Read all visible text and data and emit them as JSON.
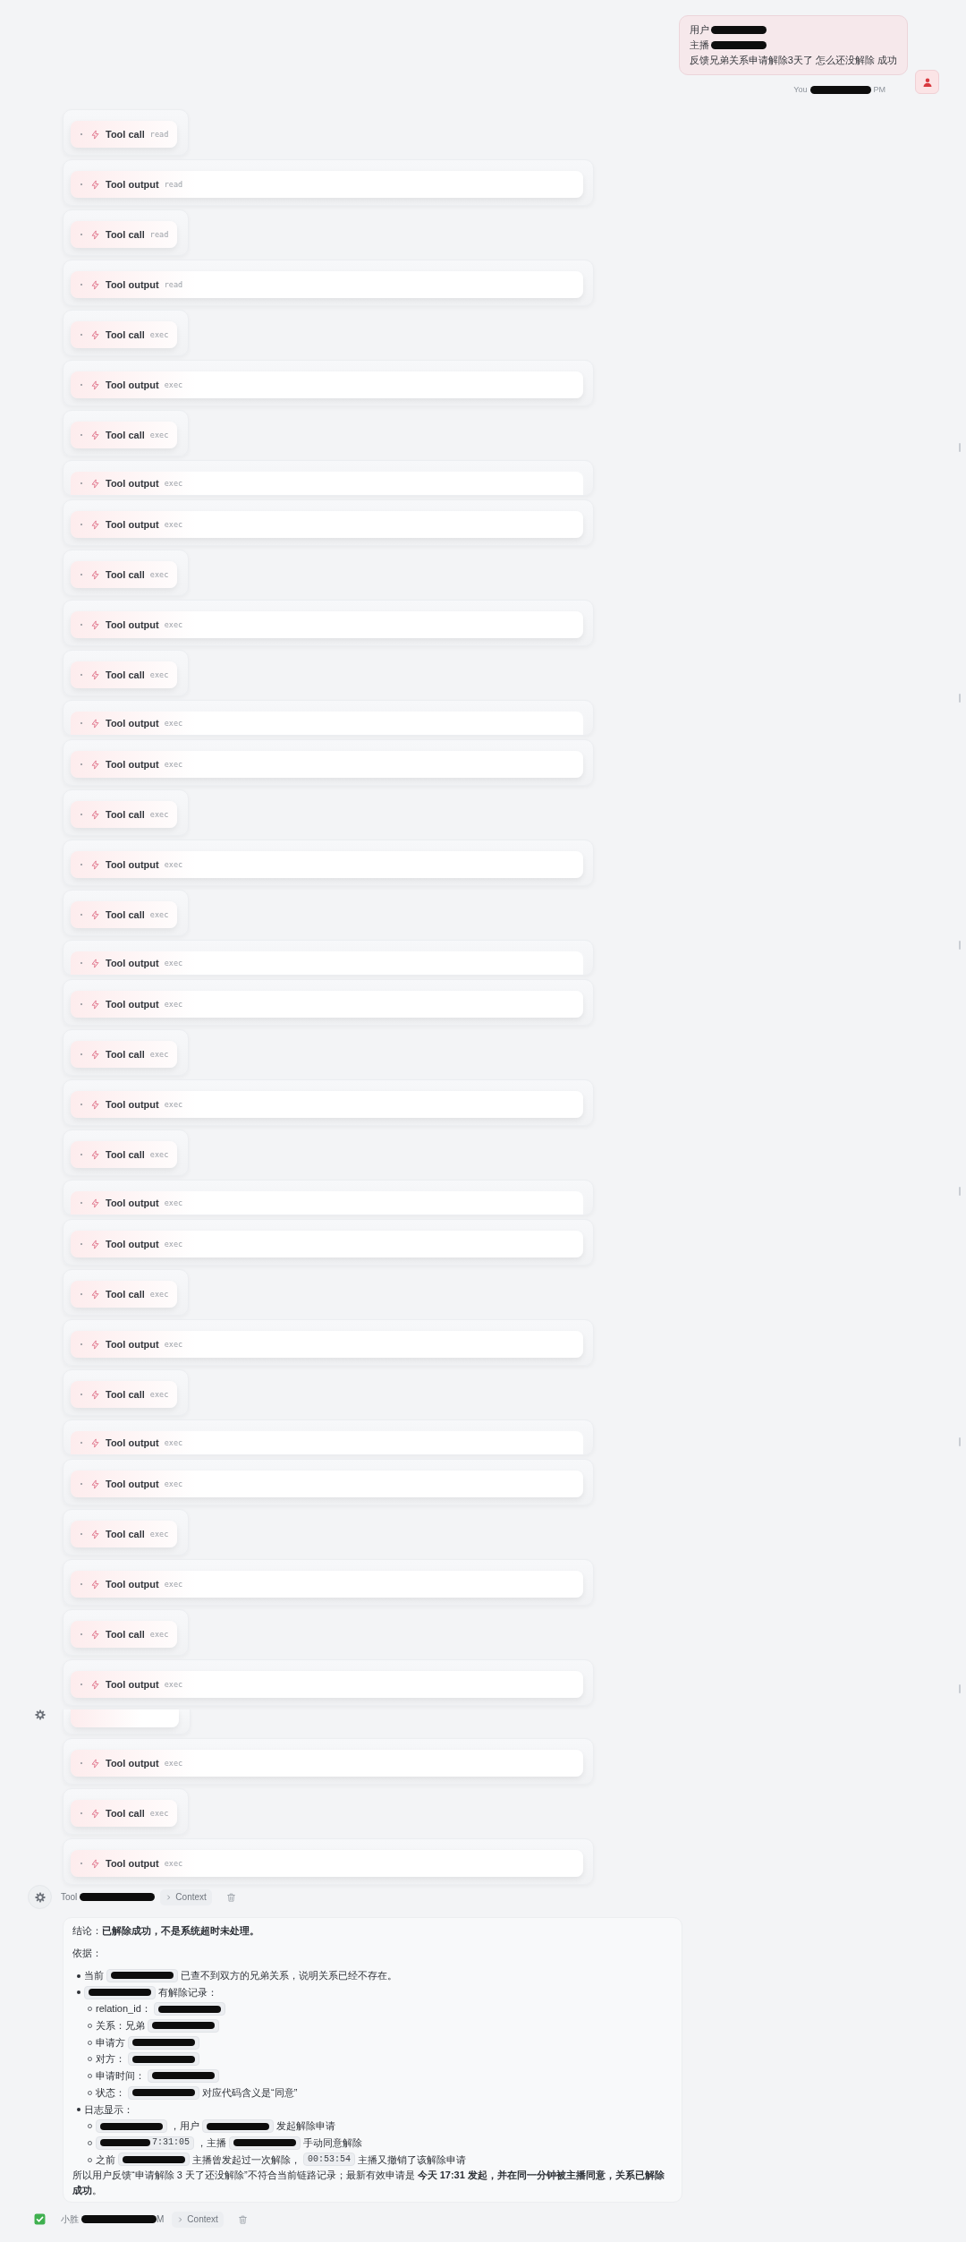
{
  "user_message": {
    "lines": [
      [
        {
          "kind": "text",
          "text": "用户"
        },
        {
          "kind": "redacted"
        }
      ],
      [
        {
          "kind": "text",
          "text": "主播"
        },
        {
          "kind": "redacted"
        }
      ],
      [
        {
          "kind": "text",
          "text": "反馈兄弟关系申请解除3天了 怎么还没解除 成功"
        }
      ]
    ],
    "meta": [
      {
        "kind": "text",
        "text": "You"
      },
      {
        "kind": "redacted"
      },
      {
        "kind": "text",
        "text": "PM"
      }
    ]
  },
  "tool_events": [
    {
      "kind": "call",
      "label": "Tool call",
      "tool": "read",
      "clipped": false
    },
    {
      "kind": "output",
      "label": "Tool output",
      "tool": "read",
      "clipped": false
    },
    {
      "kind": "call",
      "label": "Tool call",
      "tool": "read",
      "clipped": false
    },
    {
      "kind": "output",
      "label": "Tool output",
      "tool": "read",
      "clipped": false
    },
    {
      "kind": "call",
      "label": "Tool call",
      "tool": "exec",
      "clipped": false
    },
    {
      "kind": "output",
      "label": "Tool output",
      "tool": "exec",
      "clipped": false
    },
    {
      "kind": "call",
      "label": "Tool call",
      "tool": "exec",
      "clipped": false
    },
    {
      "kind": "output",
      "label": "Tool output",
      "tool": "exec",
      "clipped": true
    },
    {
      "kind": "output",
      "label": "Tool output",
      "tool": "exec",
      "clipped": false
    },
    {
      "kind": "call",
      "label": "Tool call",
      "tool": "exec",
      "clipped": false
    },
    {
      "kind": "output",
      "label": "Tool output",
      "tool": "exec",
      "clipped": false
    },
    {
      "kind": "call",
      "label": "Tool call",
      "tool": "exec",
      "clipped": false
    },
    {
      "kind": "output",
      "label": "Tool output",
      "tool": "exec",
      "clipped": true
    },
    {
      "kind": "output",
      "label": "Tool output",
      "tool": "exec",
      "clipped": false
    },
    {
      "kind": "call",
      "label": "Tool call",
      "tool": "exec",
      "clipped": false
    },
    {
      "kind": "output",
      "label": "Tool output",
      "tool": "exec",
      "clipped": false
    },
    {
      "kind": "call",
      "label": "Tool call",
      "tool": "exec",
      "clipped": false
    },
    {
      "kind": "output",
      "label": "Tool output",
      "tool": "exec",
      "clipped": true
    },
    {
      "kind": "output",
      "label": "Tool output",
      "tool": "exec",
      "clipped": false
    },
    {
      "kind": "call",
      "label": "Tool call",
      "tool": "exec",
      "clipped": false
    },
    {
      "kind": "output",
      "label": "Tool output",
      "tool": "exec",
      "clipped": false
    },
    {
      "kind": "call",
      "label": "Tool call",
      "tool": "exec",
      "clipped": false
    },
    {
      "kind": "output",
      "label": "Tool output",
      "tool": "exec",
      "clipped": true
    },
    {
      "kind": "output",
      "label": "Tool output",
      "tool": "exec",
      "clipped": false
    },
    {
      "kind": "call",
      "label": "Tool call",
      "tool": "exec",
      "clipped": false
    },
    {
      "kind": "output",
      "label": "Tool output",
      "tool": "exec",
      "clipped": false
    },
    {
      "kind": "call",
      "label": "Tool call",
      "tool": "exec",
      "clipped": false
    },
    {
      "kind": "output",
      "label": "Tool output",
      "tool": "exec",
      "clipped": true
    },
    {
      "kind": "output",
      "label": "Tool output",
      "tool": "exec",
      "clipped": false
    },
    {
      "kind": "call",
      "label": "Tool call",
      "tool": "exec",
      "clipped": false
    },
    {
      "kind": "output",
      "label": "Tool output",
      "tool": "exec",
      "clipped": false
    },
    {
      "kind": "call",
      "label": "Tool call",
      "tool": "exec",
      "clipped": false
    },
    {
      "kind": "output",
      "label": "Tool output",
      "tool": "exec",
      "clipped": false
    },
    {
      "kind": "covered"
    },
    {
      "kind": "output",
      "label": "Tool output",
      "tool": "exec",
      "clipped": false
    },
    {
      "kind": "call",
      "label": "Tool call",
      "tool": "exec",
      "clipped": false
    },
    {
      "kind": "output",
      "label": "Tool output",
      "tool": "exec",
      "clipped": false
    }
  ],
  "tool_footer": {
    "segments": [
      {
        "kind": "text",
        "text": "Tool"
      },
      {
        "kind": "redacted"
      }
    ],
    "context": "Context"
  },
  "answer": {
    "conclusion": "结论：**已解除成功，不是系统超时未处理。**",
    "basis_label": "依据：",
    "bullets": [
      {
        "segments": [
          {
            "kind": "text",
            "text": "当前"
          },
          {
            "kind": "redacted-code"
          },
          {
            "kind": "text",
            "text": "已查不到双方的兄弟关系，说明关系已经不存在。"
          }
        ]
      },
      {
        "segments": [
          {
            "kind": "redacted-code"
          },
          {
            "kind": "text",
            "text": "有解除记录："
          }
        ],
        "children": [
          {
            "segments": [
              {
                "kind": "text",
                "text": "relation_id："
              },
              {
                "kind": "redacted-code"
              }
            ]
          },
          {
            "segments": [
              {
                "kind": "text",
                "text": "关系：兄弟"
              },
              {
                "kind": "redacted-code"
              }
            ]
          },
          {
            "segments": [
              {
                "kind": "text",
                "text": "申请方"
              },
              {
                "kind": "redacted-code"
              }
            ]
          },
          {
            "segments": [
              {
                "kind": "text",
                "text": "对方："
              },
              {
                "kind": "redacted-code"
              }
            ]
          },
          {
            "segments": [
              {
                "kind": "text",
                "text": "申请时间："
              },
              {
                "kind": "redacted-code"
              }
            ]
          },
          {
            "segments": [
              {
                "kind": "text",
                "text": "状态："
              },
              {
                "kind": "redacted-code"
              },
              {
                "kind": "text",
                "text": "对应代码含义是“同意”"
              }
            ]
          }
        ]
      },
      {
        "segments": [
          {
            "kind": "text",
            "text": "日志显示："
          }
        ],
        "children": [
          {
            "segments": [
              {
                "kind": "redacted-code"
              },
              {
                "kind": "text",
                "text": "，用户"
              },
              {
                "kind": "redacted-code"
              },
              {
                "kind": "text",
                "text": "发起解除申请"
              }
            ]
          },
          {
            "segments": [
              {
                "kind": "code",
                "text": "7:31:05",
                "redacted": true
              },
              {
                "kind": "text",
                "text": "，主播"
              },
              {
                "kind": "redacted-code"
              },
              {
                "kind": "text",
                "text": "手动同意解除"
              }
            ]
          },
          {
            "segments": [
              {
                "kind": "text",
                "text": "之前"
              },
              {
                "kind": "redacted-code"
              },
              {
                "kind": "text",
                "text": "主播曾发起过一次解除，"
              },
              {
                "kind": "code",
                "text": "00:53:54",
                "redacted": false
              },
              {
                "kind": "text",
                "text": "主播又撤销了该解除申请"
              }
            ]
          }
        ]
      }
    ],
    "summary": "所以用户反馈“申请解除 3 天了还没解除”不符合当前链路记录；最新有效申请是 **今天 17:31 发起，并在同一分钟被主播同意，关系已解除成功**。"
  },
  "answer_footer": {
    "segments": [
      {
        "kind": "text",
        "text": "小胜"
      },
      {
        "kind": "redacted"
      },
      {
        "kind": "text",
        "text": "M"
      }
    ],
    "context": "Context"
  }
}
